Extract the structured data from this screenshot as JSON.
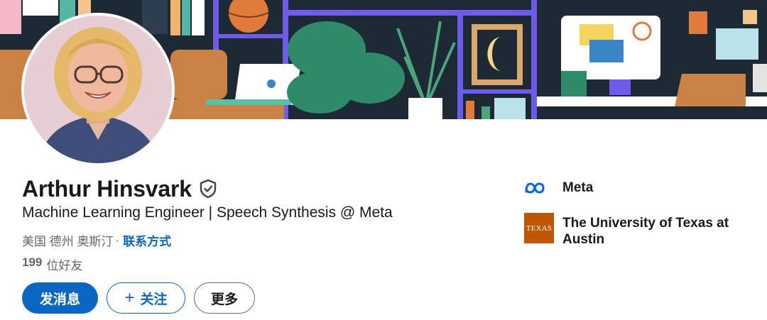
{
  "profile": {
    "name": "Arthur Hinsvark",
    "headline": "Machine Learning Engineer | Speech Synthesis @ Meta",
    "location": "美国 德州 奥斯汀",
    "separator": "·",
    "contact_link": "联系方式",
    "connections_count": "199",
    "connections_label": "位好友"
  },
  "actions": {
    "message_label": "发消息",
    "follow_plus": "+",
    "follow_label": "关注",
    "more_label": "更多"
  },
  "experience": {
    "company": "Meta",
    "company_logo": "meta-infinity-logo"
  },
  "education": {
    "school": "The University of Texas at Austin",
    "school_logo_text": "TEXAS"
  },
  "colors": {
    "accent": "#0a66c2",
    "ut_orange": "#bf5700",
    "meta_blue": "#0668e1"
  }
}
